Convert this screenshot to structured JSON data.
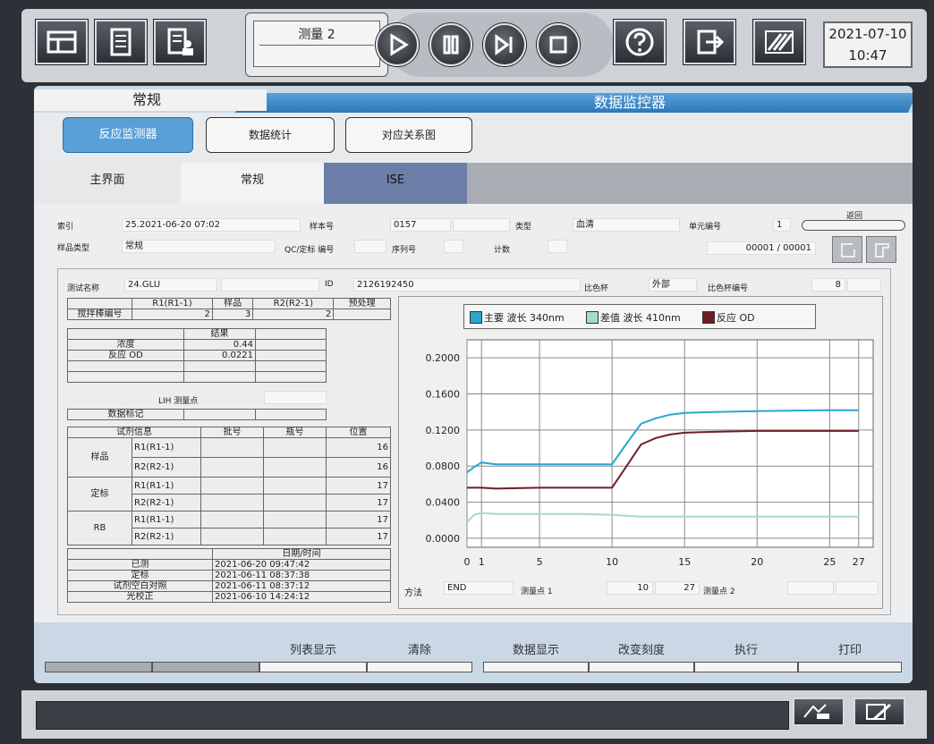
{
  "toolbar": {
    "measure_label": "测量 2",
    "date": "2021-07-10",
    "time": "10:47"
  },
  "header": {
    "left_title": "常规",
    "right_title": "数据监控器"
  },
  "subtabs": [
    "反应监测器",
    "数据统计",
    "对应关系图"
  ],
  "tabs": [
    "主界面",
    "常规",
    "ISE"
  ],
  "info": {
    "index_label": "索引",
    "index_value": "25.2021-06-20 07:02",
    "sample_no_label": "样本号",
    "sample_no_value": "0157",
    "type_label": "类型",
    "type_value": "血清",
    "unit_no_label": "单元编号",
    "unit_no_value": "1",
    "back_label": "返回",
    "sample_type_label": "样品类型",
    "sample_type_value": "常规",
    "qc_label": "QC/定标 编号",
    "seq_label": "序列号",
    "count_label": "计数",
    "page_value": "00001 / 00001",
    "test_name_label": "测试名称",
    "test_name_value": "24.GLU",
    "id_label": "ID",
    "id_value": "2126192450",
    "cuvette_label": "比色杯",
    "cuvette_value": "外部",
    "cuvette_no_label": "比色杯编号",
    "cuvette_no_value": "8"
  },
  "stir_table": {
    "headers": [
      "",
      "R1(R1-1)",
      "样品",
      "R2(R2-1)",
      "预处理"
    ],
    "row_label": "搅拌棒编号",
    "values": [
      "2",
      "3",
      "2",
      ""
    ]
  },
  "result_table": {
    "header": "结果",
    "rows": [
      {
        "label": "浓度",
        "value": "0.44"
      },
      {
        "label": "反应 OD",
        "value": "0.0221"
      }
    ]
  },
  "lih_label": "LIH 测量点",
  "data_mark_label": "数据标记",
  "reagent_table": {
    "headers": [
      "试剂信息",
      "批号",
      "瓶号",
      "位置"
    ],
    "groups": [
      {
        "name": "样品",
        "rows": [
          {
            "r": "R1(R1-1)",
            "pos": "16"
          },
          {
            "r": "R2(R2-1)",
            "pos": "16"
          }
        ]
      },
      {
        "name": "定标",
        "rows": [
          {
            "r": "R1(R1-1)",
            "pos": "17"
          },
          {
            "r": "R2(R2-1)",
            "pos": "17"
          }
        ]
      },
      {
        "name": "RB",
        "rows": [
          {
            "r": "R1(R1-1)",
            "pos": "17"
          },
          {
            "r": "R2(R2-1)",
            "pos": "17"
          }
        ]
      }
    ]
  },
  "date_table": {
    "header": "日期/时间",
    "rows": [
      {
        "label": "已测",
        "value": "2021-06-20 09:47:42"
      },
      {
        "label": "定标",
        "value": "2021-06-11 08:37:38"
      },
      {
        "label": "试剂空白对照",
        "value": "2021-06-11 08:37:12"
      },
      {
        "label": "光校正",
        "value": "2021-06-10 14:24:12"
      }
    ]
  },
  "method": {
    "method_label": "方法",
    "method_value": "END",
    "point1_label": "测量点 1",
    "point1_a": "10",
    "point1_b": "27",
    "point2_label": "测量点 2"
  },
  "chart_data": {
    "type": "line",
    "x_ticks": [
      0,
      1,
      5,
      10,
      15,
      20,
      25,
      27
    ],
    "xlim": [
      0,
      28
    ],
    "ylim": [
      -0.01,
      0.22
    ],
    "y_ticks": [
      "0.2000",
      "0.1600",
      "0.1200",
      "0.0800",
      "0.0400",
      "0.0000"
    ],
    "y_tick_values": [
      0.2,
      0.16,
      0.12,
      0.08,
      0.04,
      0.0
    ],
    "grid": true,
    "legend_position": "top",
    "series": [
      {
        "name": "主要 波长 340nm",
        "color": "#2aa6cf",
        "x": [
          0,
          0.5,
          1,
          2,
          5,
          8,
          10,
          11,
          12,
          13,
          14,
          15,
          17,
          20,
          25,
          27
        ],
        "y": [
          0.073,
          0.079,
          0.084,
          0.082,
          0.082,
          0.082,
          0.082,
          0.105,
          0.127,
          0.133,
          0.137,
          0.139,
          0.14,
          0.141,
          0.142,
          0.142
        ]
      },
      {
        "name": "差值 波长 410nm",
        "color": "#a6dcbf",
        "x": [
          0,
          0.5,
          1,
          2,
          5,
          8,
          10,
          11,
          12,
          15,
          20,
          25,
          27
        ],
        "y": [
          0.018,
          0.026,
          0.028,
          0.027,
          0.027,
          0.027,
          0.026,
          0.025,
          0.024,
          0.024,
          0.024,
          0.024,
          0.024
        ]
      },
      {
        "name": "反应 OD",
        "color": "#6e1e24",
        "x": [
          0,
          1,
          2,
          5,
          8,
          10,
          11,
          12,
          13,
          14,
          15,
          17,
          20,
          25,
          27
        ],
        "y": [
          0.056,
          0.056,
          0.055,
          0.056,
          0.056,
          0.056,
          0.08,
          0.104,
          0.111,
          0.115,
          0.117,
          0.118,
          0.119,
          0.119,
          0.119
        ]
      }
    ]
  },
  "bottom_buttons": [
    "列表显示",
    "清除",
    "数据显示",
    "改变刻度",
    "执行",
    "打印"
  ]
}
